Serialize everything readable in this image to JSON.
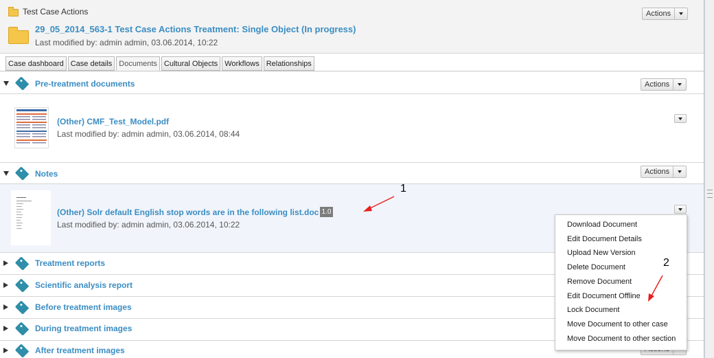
{
  "header": {
    "top_title": "Test Case Actions",
    "case_title": "29_05_2014_563-1 Test Case Actions Treatment: Single Object (In progress)",
    "last_modified": "Last modified by: admin admin, 03.06.2014, 10:22",
    "actions_label": "Actions"
  },
  "tabs": [
    {
      "label": "Case dashboard"
    },
    {
      "label": "Case details"
    },
    {
      "label": "Documents",
      "active": true
    },
    {
      "label": "Cultural Objects"
    },
    {
      "label": "Workflows"
    },
    {
      "label": "Relationships"
    }
  ],
  "sections": [
    {
      "title": "Pre-treatment documents",
      "expanded": true,
      "actions_label": "Actions"
    },
    {
      "title": "Notes",
      "expanded": true,
      "actions_label": "Actions"
    },
    {
      "title": "Treatment reports",
      "expanded": false
    },
    {
      "title": "Scientific analysis report",
      "expanded": false
    },
    {
      "title": "Before treatment images",
      "expanded": false
    },
    {
      "title": "During treatment images",
      "expanded": false
    },
    {
      "title": "After treatment images",
      "expanded": false,
      "actions_label": "Actions"
    }
  ],
  "documents": [
    {
      "title": "(Other) CMF_Test_Model.pdf",
      "last_modified": "Last modified by: admin admin, 03.06.2014, 08:44"
    },
    {
      "title": "(Other) Solr default English stop words are in the following list.doc",
      "version": "1.0",
      "last_modified": "Last modified by: admin admin, 03.06.2014, 10:22"
    }
  ],
  "context_menu": {
    "items": [
      "Download Document",
      "Edit Document Details",
      "Upload New Version",
      "Delete Document",
      "Remove Document",
      "Edit Document Offline",
      "Lock Document",
      "Move Document to other case",
      "Move Document to other section"
    ]
  },
  "annotations": {
    "label_1": "1",
    "label_2": "2",
    "color": "#e8201e"
  },
  "colors": {
    "link": "#3b8dc3",
    "tag": "#2f8ea9",
    "folder": "#f6c64a",
    "selected_row": "#f1f5fb"
  }
}
